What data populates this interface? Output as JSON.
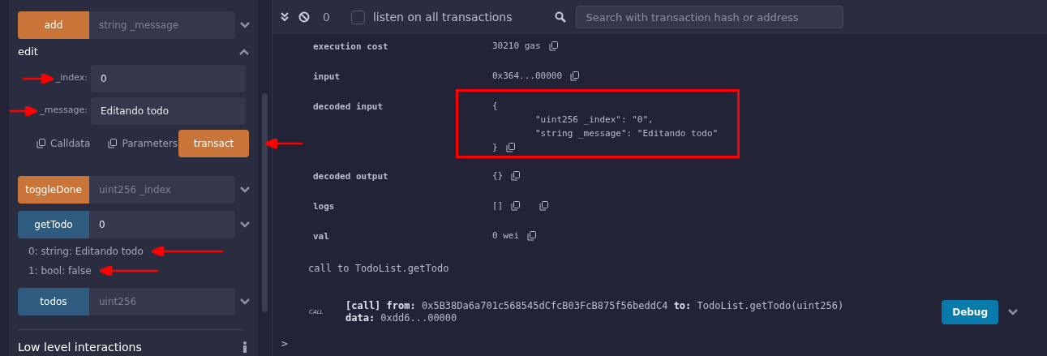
{
  "functions": [
    {
      "label": "add",
      "kind": "transact",
      "expanded": false,
      "placeholder": "string _message"
    },
    {
      "label": "edit",
      "kind": "transact",
      "expanded": true,
      "params": [
        {
          "label": "_index:",
          "value": "0"
        },
        {
          "label": "_message:",
          "value": "Editando todo"
        }
      ],
      "actions": [
        "Calldata",
        "Parameters"
      ],
      "submit": "transact"
    },
    {
      "label": "toggleDone",
      "kind": "transact",
      "expanded": false,
      "placeholder": "uint256 _index"
    },
    {
      "label": "getTodo",
      "kind": "call",
      "expanded": false,
      "value": "0",
      "outputs": [
        "0: string: Editando todo",
        "1: bool: false"
      ]
    },
    {
      "label": "todos",
      "kind": "call",
      "expanded": false,
      "placeholder": "uint256"
    }
  ],
  "low_level": "Low level interactions",
  "terminal": {
    "count": "0",
    "listen_label": "listen on all transactions",
    "listen_checked": false,
    "search_placeholder": "Search with transaction hash or address",
    "details": [
      {
        "label": "execution cost",
        "second_copy": false,
        "lines": [
          "30210 gas"
        ]
      },
      {
        "label": "input",
        "second_copy": false,
        "lines": [
          "0x364...00000"
        ]
      },
      {
        "label": "decoded input",
        "second_copy": false,
        "lines": [
          "{",
          "        \"uint256 _index\": \"0\",",
          "        \"string _message\": \"Editando todo\"",
          "}"
        ]
      },
      {
        "label": "decoded output",
        "second_copy": false,
        "lines": [
          "{}"
        ]
      },
      {
        "label": "logs",
        "second_copy": true,
        "lines": [
          "[]"
        ]
      },
      {
        "label": "val",
        "second_copy": false,
        "lines": [
          "0 wei"
        ]
      }
    ],
    "call_text": "call to TodoList.getTodo",
    "log": {
      "tag": "CALL",
      "call": "[call]",
      "from_label": "from:",
      "from": "0x5B38Da6a701c568545dCfcB03FcB875f56beddC4",
      "to_label": "to:",
      "to": "TodoList.getTodo(uint256)",
      "data_label": "data:",
      "data": "0xdd6...00000",
      "debug": "Debug"
    },
    "prompt": ">"
  }
}
